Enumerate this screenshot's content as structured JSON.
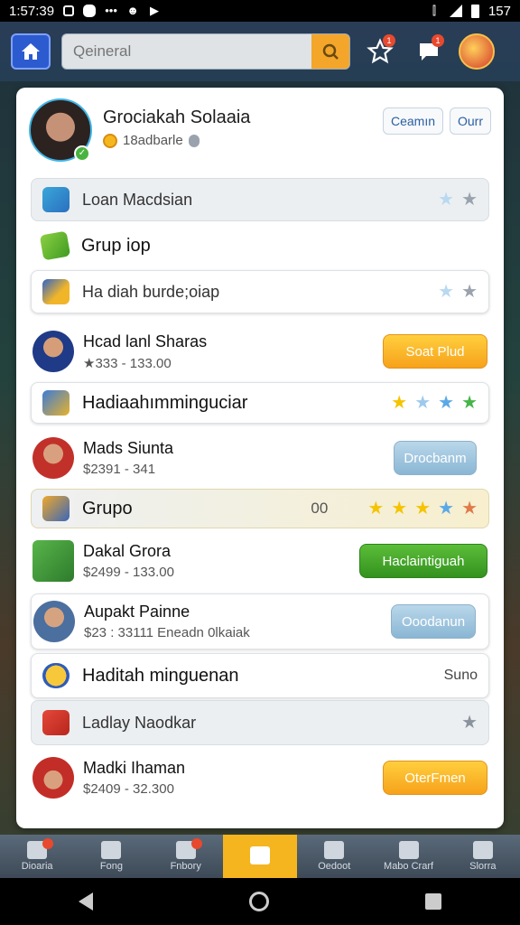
{
  "status_bar": {
    "time": "1:57:39",
    "right_text": "157"
  },
  "top_bar": {
    "search_placeholder": "Qeineral",
    "star_badge": "1",
    "chat_badge": "1"
  },
  "profile": {
    "name": "Grociakah Solaaia",
    "sub": "18adbarle",
    "btn1": "Ceamın",
    "btn2": "Ourr"
  },
  "rows": [
    {
      "label": "Loan Macdsian"
    },
    {
      "label": "Grup iop"
    },
    {
      "label": "Ha diah burde;oiap"
    },
    {
      "label": "Hadiaahımminguciar"
    },
    {
      "label": "Grupo",
      "count": "00"
    },
    {
      "label": "Haditah minguenan",
      "extra": "Suno"
    },
    {
      "label": "Ladlay Naodkar"
    }
  ],
  "people": [
    {
      "name": "Hcad lanl Sharas",
      "meta": "★333 - 133.00",
      "button": "Soat Plud"
    },
    {
      "name": "Mads Siunta",
      "meta": "$2391 - 341",
      "button": "Drocbanm"
    },
    {
      "name": "Dakal Grora",
      "meta": "$2499 - 133.00",
      "button": "Haclaintiguah"
    },
    {
      "name": "Aupakt Painne",
      "meta": "$23 : 33111 Eneadn 0lkaiak",
      "button": "Ooodanun"
    },
    {
      "name": "Madki Ihaman",
      "meta": "$2409 - 32.300",
      "button": "OterFmen"
    }
  ],
  "bottom_nav": [
    {
      "label": "Dioaria"
    },
    {
      "label": "Fong"
    },
    {
      "label": "Fnbory"
    },
    {
      "label": ""
    },
    {
      "label": "Oedoot"
    },
    {
      "label": "Mabo Crarf"
    },
    {
      "label": "Slorra"
    }
  ],
  "colors": {
    "accent": "#f4b51f",
    "primary": "#2c5bd0"
  }
}
